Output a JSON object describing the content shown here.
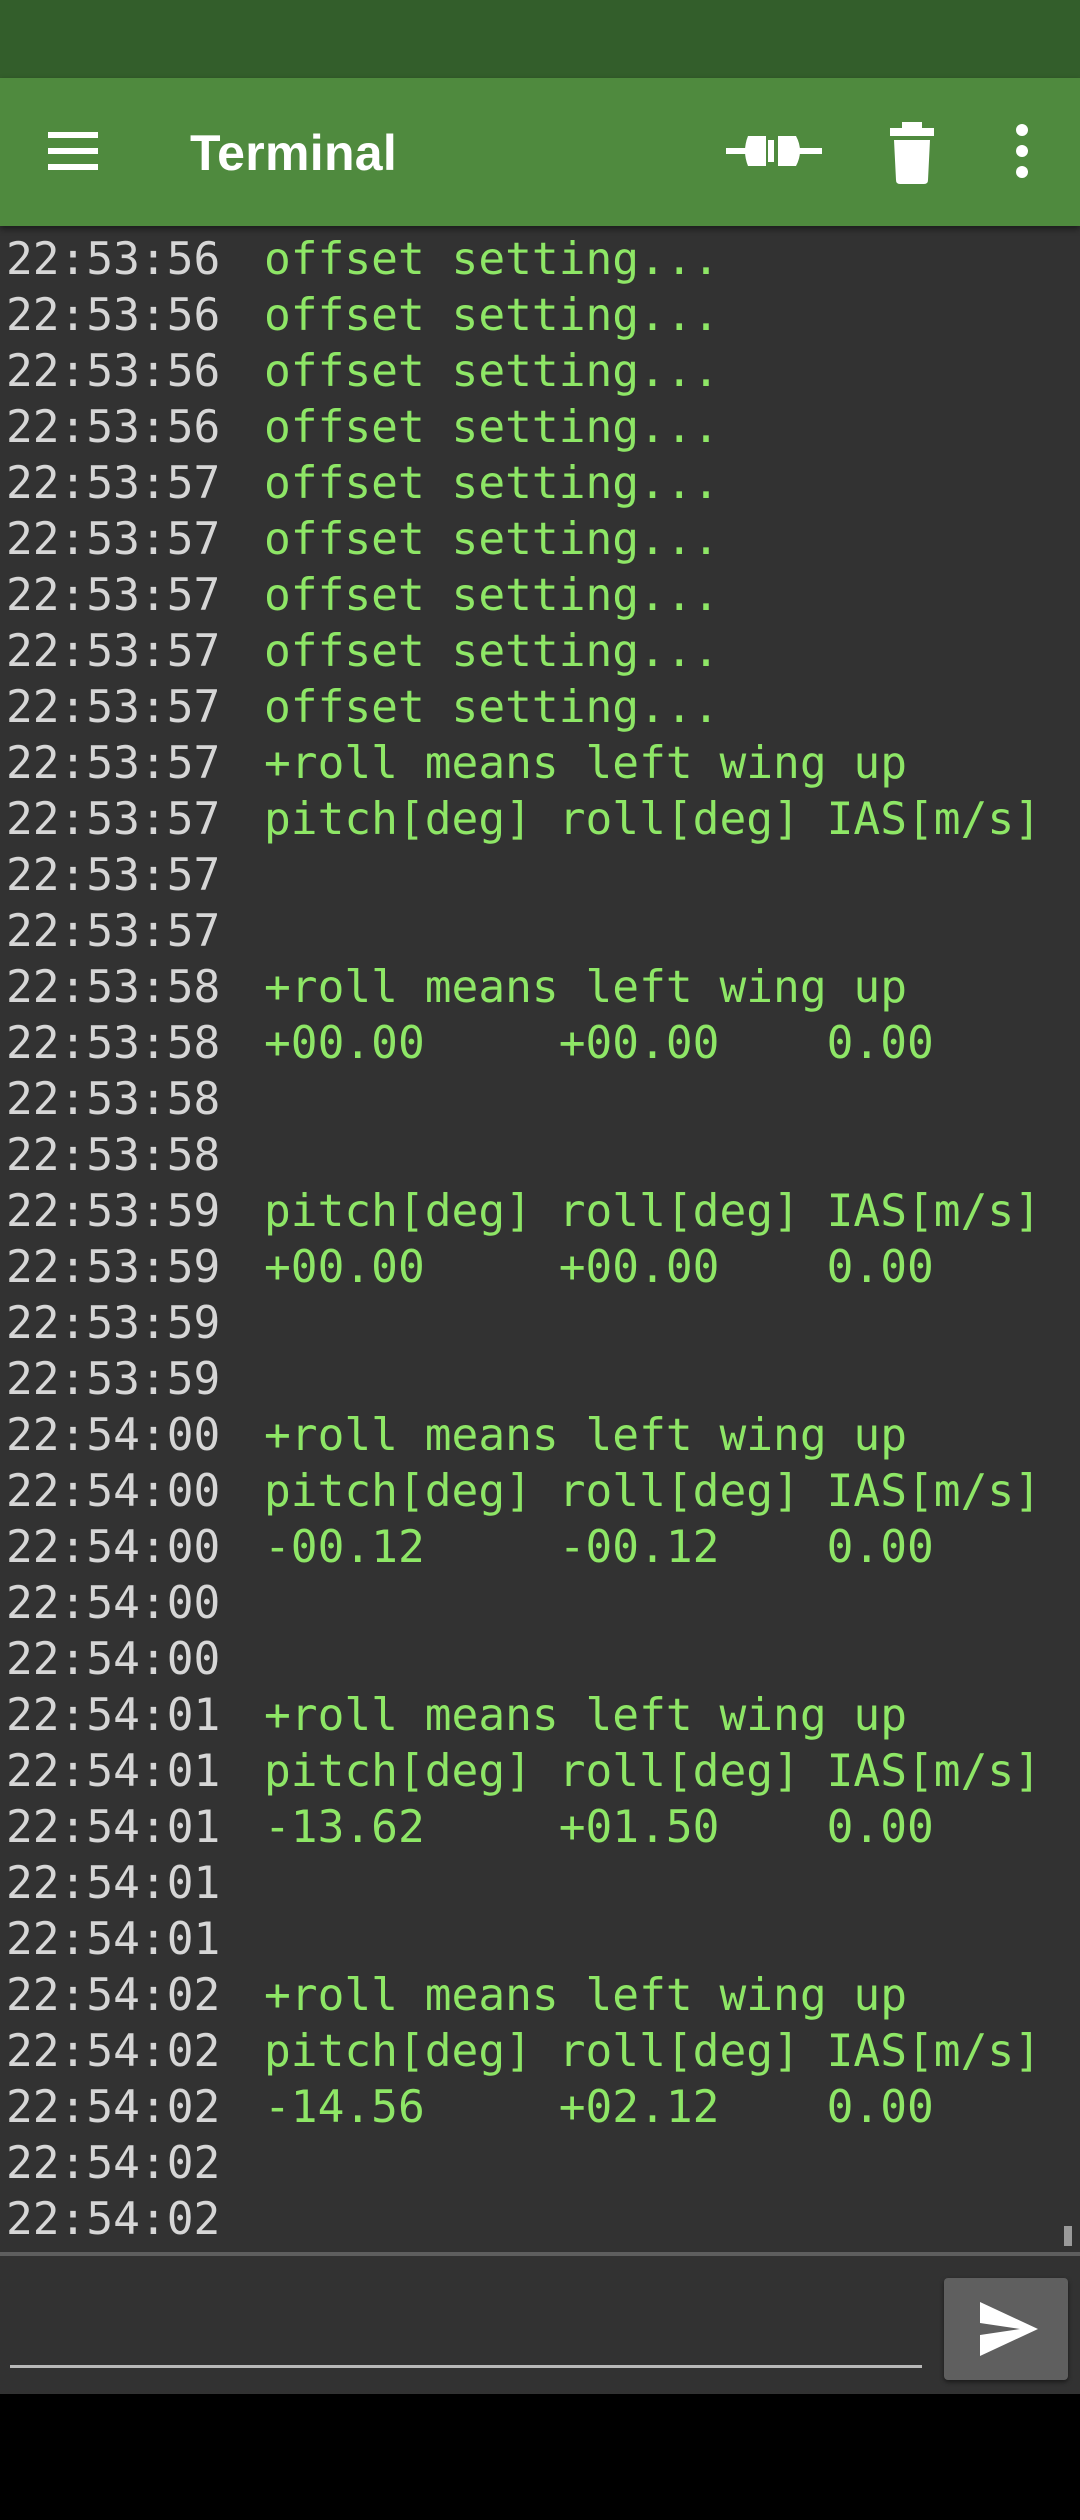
{
  "colors": {
    "status_bar": "#335e2b",
    "app_bar": "#4f8a3e",
    "terminal_bg": "#323232",
    "timestamp_text": "#d6d6d6",
    "message_text": "#8ee666",
    "send_button": "#5f5f5f"
  },
  "app_bar": {
    "title": "Terminal",
    "menu_icon": "hamburger-menu-icon",
    "connect_icon": "connect-plug-icon",
    "delete_icon": "trash-icon",
    "overflow_icon": "more-vertical-icon"
  },
  "terminal": {
    "lines": [
      {
        "time": "22:53:56",
        "text": "offset setting..."
      },
      {
        "time": "22:53:56",
        "text": "offset setting..."
      },
      {
        "time": "22:53:56",
        "text": "offset setting..."
      },
      {
        "time": "22:53:56",
        "text": "offset setting..."
      },
      {
        "time": "22:53:57",
        "text": "offset setting..."
      },
      {
        "time": "22:53:57",
        "text": "offset setting..."
      },
      {
        "time": "22:53:57",
        "text": "offset setting..."
      },
      {
        "time": "22:53:57",
        "text": "offset setting..."
      },
      {
        "time": "22:53:57",
        "text": "offset setting..."
      },
      {
        "time": "22:53:57",
        "text": "+roll means left wing up"
      },
      {
        "time": "22:53:57",
        "text": "pitch[deg] roll[deg] IAS[m/s]"
      },
      {
        "time": "22:53:57",
        "text": ""
      },
      {
        "time": "22:53:57",
        "text": ""
      },
      {
        "time": "22:53:58",
        "text": "+roll means left wing up"
      },
      {
        "time": "22:53:58",
        "text": "+00.00     +00.00    0.00"
      },
      {
        "time": "22:53:58",
        "text": ""
      },
      {
        "time": "22:53:58",
        "text": ""
      },
      {
        "time": "22:53:59",
        "text": "pitch[deg] roll[deg] IAS[m/s]"
      },
      {
        "time": "22:53:59",
        "text": "+00.00     +00.00    0.00"
      },
      {
        "time": "22:53:59",
        "text": ""
      },
      {
        "time": "22:53:59",
        "text": ""
      },
      {
        "time": "22:54:00",
        "text": "+roll means left wing up"
      },
      {
        "time": "22:54:00",
        "text": "pitch[deg] roll[deg] IAS[m/s]"
      },
      {
        "time": "22:54:00",
        "text": "-00.12     -00.12    0.00"
      },
      {
        "time": "22:54:00",
        "text": ""
      },
      {
        "time": "22:54:00",
        "text": ""
      },
      {
        "time": "22:54:01",
        "text": "+roll means left wing up"
      },
      {
        "time": "22:54:01",
        "text": "pitch[deg] roll[deg] IAS[m/s]"
      },
      {
        "time": "22:54:01",
        "text": "-13.62     +01.50    0.00"
      },
      {
        "time": "22:54:01",
        "text": ""
      },
      {
        "time": "22:54:01",
        "text": ""
      },
      {
        "time": "22:54:02",
        "text": "+roll means left wing up"
      },
      {
        "time": "22:54:02",
        "text": "pitch[deg] roll[deg] IAS[m/s]"
      },
      {
        "time": "22:54:02",
        "text": "-14.56     +02.12    0.00"
      },
      {
        "time": "22:54:02",
        "text": ""
      },
      {
        "time": "22:54:02",
        "text": ""
      }
    ]
  },
  "input": {
    "value": "",
    "placeholder": "",
    "send_icon": "send-icon"
  }
}
